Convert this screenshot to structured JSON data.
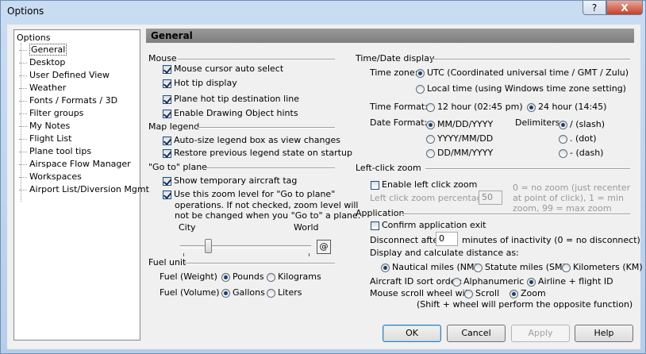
{
  "window": {
    "title": "Options",
    "help_glyph": "?",
    "close_glyph": "X"
  },
  "tree": {
    "root": "Options",
    "items": [
      "General",
      "Desktop",
      "User Defined View",
      "Weather",
      "Fonts / Formats / 3D",
      "Filter groups",
      "My Notes",
      "Flight List",
      "Plane tool tips",
      "Airspace Flow Manager",
      "Workspaces",
      "Airport List/Diversion Mgmt"
    ],
    "selected": "General"
  },
  "panel": {
    "header": "General"
  },
  "mouse": {
    "title": "Mouse",
    "auto_select": "Mouse cursor auto select",
    "hot_tip": "Hot tip display",
    "hot_tip_dest": "Plane hot tip destination line",
    "drawing_hints": "Enable Drawing Object hints"
  },
  "map_legend": {
    "title": "Map legend",
    "auto_size": "Auto-size legend box as view changes",
    "restore": "Restore previous legend state on startup"
  },
  "goto": {
    "title": "\"Go to\" plane",
    "show_tag": "Show temporary aircraft tag",
    "use_zoom_1": "Use this zoom level for \"Go to plane\"",
    "use_zoom_2": "operations.  If not checked, zoom level will",
    "use_zoom_3": "not be changed when you \"Go to\" a plane.",
    "city": "City",
    "world": "World",
    "at": "@",
    "zoom_level": 0.2
  },
  "fuel": {
    "title": "Fuel unit",
    "weight_label": "Fuel (Weight)",
    "pounds": "Pounds",
    "kilograms": "Kilograms",
    "volume_label": "Fuel (Volume)",
    "gallons": "Gallons",
    "liters": "Liters"
  },
  "time": {
    "title": "Time/Date display",
    "zone_label": "Time zone:",
    "utc": "UTC (Coordinated universal time / GMT  /  Zulu)",
    "local": "Local time (using Windows time zone setting)",
    "format_label": "Time Format:",
    "h12": "12 hour (02:45 pm)",
    "h24": "24 hour (14:45)",
    "date_label": "Date Format:",
    "mdy": "MM/DD/YYYY",
    "ymd": "YYYY/MM/DD",
    "dmy": "DD/MM/YYYY",
    "delim_label": "Delimiters:",
    "slash": "/ (slash)",
    "dot": ". (dot)",
    "dash": "- (dash)"
  },
  "left_click": {
    "title": "Left-click zoom",
    "enable": "Enable left click zoom",
    "pct_label": "Left click zoom percentage:",
    "pct_value": "50",
    "note_1": "0 = no zoom (just recenter",
    "note_2": "at point of click), 1 = min",
    "note_3": "zoom, 99 = max zoom"
  },
  "application": {
    "title": "Application",
    "confirm_exit": "Confirm application exit",
    "disconnect_label": "Disconnect after",
    "disconnect_value": "0",
    "disconnect_suffix": "minutes of inactivity (0 = no disconnect)",
    "distance_label": "Display and calculate distance as:",
    "nm": "Nautical miles (NM)",
    "sm": "Statute miles (SM)",
    "km": "Kilometers (KM)",
    "sort_label": "Aircraft ID sort order:",
    "alpha": "Alphanumeric",
    "airline": "Airline + flight ID",
    "scroll_label": "Mouse scroll wheel will:",
    "scroll": "Scroll",
    "zoom": "Zoom",
    "scroll_note": "(Shift + wheel will perform the opposite function)"
  },
  "buttons": {
    "ok": "OK",
    "cancel": "Cancel",
    "apply": "Apply",
    "help": "Help"
  }
}
